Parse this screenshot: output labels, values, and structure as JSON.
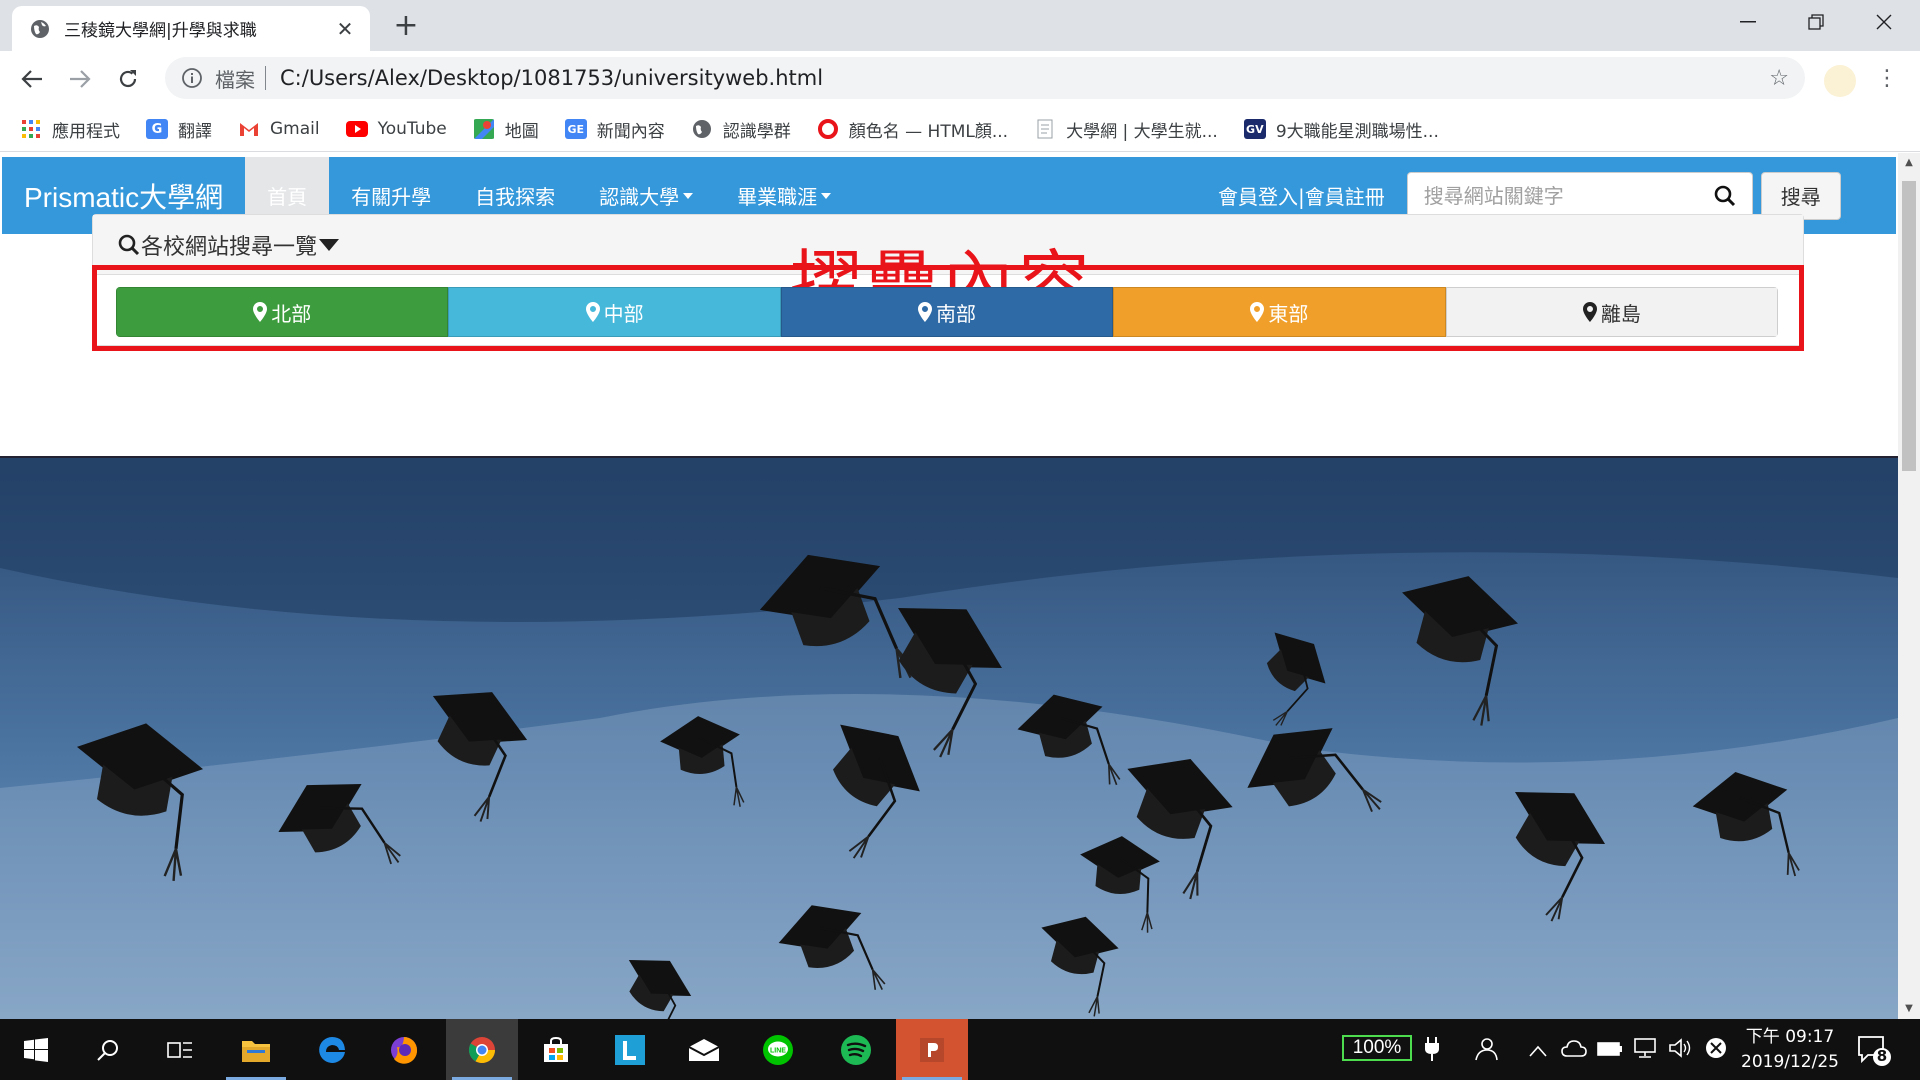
{
  "browser": {
    "tab_title": "三稜鏡大學網|升學與求職",
    "omnibox_label": "檔案",
    "url": "C:/Users/Alex/Desktop/1081753/universityweb.html",
    "bookmarks": [
      {
        "label": "應用程式",
        "icon": "apps-grid-icon"
      },
      {
        "label": "翻譯",
        "icon": "translate-icon"
      },
      {
        "label": "Gmail",
        "icon": "gmail-icon"
      },
      {
        "label": "YouTube",
        "icon": "youtube-icon"
      },
      {
        "label": "地圖",
        "icon": "maps-icon"
      },
      {
        "label": "新聞內容",
        "icon": "news-icon"
      },
      {
        "label": "認識學群",
        "icon": "globe-icon"
      },
      {
        "label": "顏色名 — HTML顏...",
        "icon": "opera-icon"
      },
      {
        "label": "大學網 | 大學生就...",
        "icon": "page-icon"
      },
      {
        "label": "9大職能星測職場性...",
        "icon": "gv-icon"
      }
    ]
  },
  "site": {
    "brand": "Prismatic大學網",
    "nav": [
      {
        "label": "首頁",
        "active": true,
        "dropdown": false
      },
      {
        "label": "有關升學",
        "active": false,
        "dropdown": false
      },
      {
        "label": "自我探索",
        "active": false,
        "dropdown": false
      },
      {
        "label": "認識大學",
        "active": false,
        "dropdown": true
      },
      {
        "label": "畢業職涯",
        "active": false,
        "dropdown": true
      }
    ],
    "login": "會員登入|會員註冊",
    "search_placeholder": "搜尋網站關鍵字",
    "search_button": "搜尋",
    "panel_title": "各校網站搜尋一覽",
    "annotation": "摺疊內容",
    "regions": [
      {
        "label": "北部",
        "color": "#3d9c3d"
      },
      {
        "label": "中部",
        "color": "#46b8da"
      },
      {
        "label": "南部",
        "color": "#2d6aa6"
      },
      {
        "label": "東部",
        "color": "#f0a02a"
      },
      {
        "label": "離島",
        "color": "#f2f2f2"
      }
    ]
  },
  "taskbar": {
    "battery": "100%",
    "time": "下午 09:17",
    "date": "2019/12/25",
    "notifications": "8"
  }
}
